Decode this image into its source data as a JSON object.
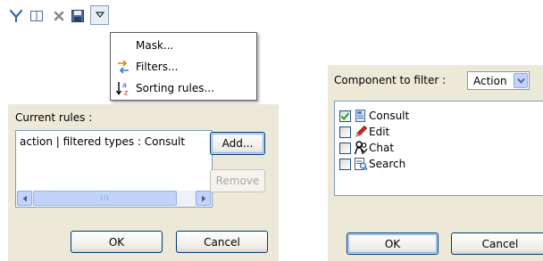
{
  "toolbar": {
    "buttons": [
      {
        "icon": "filter-funnel-icon"
      },
      {
        "icon": "columns-icon"
      },
      {
        "icon": "delete-icon"
      },
      {
        "icon": "save-icon"
      }
    ],
    "dropdown_icon": "chevron-down-icon"
  },
  "menu": {
    "items": [
      {
        "label": "Mask...",
        "icon": ""
      },
      {
        "label": "Filters...",
        "icon": "filters-icon"
      },
      {
        "label": "Sorting rules...",
        "icon": "sort-az-icon"
      }
    ]
  },
  "rules_dialog": {
    "title": "Current rules :",
    "rules": [
      "action | filtered types : Consult"
    ],
    "scroll_grip": "III",
    "add_label": "Add...",
    "remove_label": "Remove",
    "ok_label": "OK",
    "cancel_label": "Cancel"
  },
  "filter_dialog": {
    "component_label": "Component to filter :",
    "component_value": "Action",
    "types": [
      {
        "label": "Consult",
        "checked": true
      },
      {
        "label": "Edit",
        "checked": false
      },
      {
        "label": "Chat",
        "checked": false
      },
      {
        "label": "Search",
        "checked": false
      }
    ],
    "ok_label": "OK",
    "cancel_label": "Cancel"
  },
  "colors": {
    "dialog_bg": "#ece9d8",
    "button_border": "#003c74",
    "check_green": "#21a121",
    "list_border": "#7f9db9"
  }
}
